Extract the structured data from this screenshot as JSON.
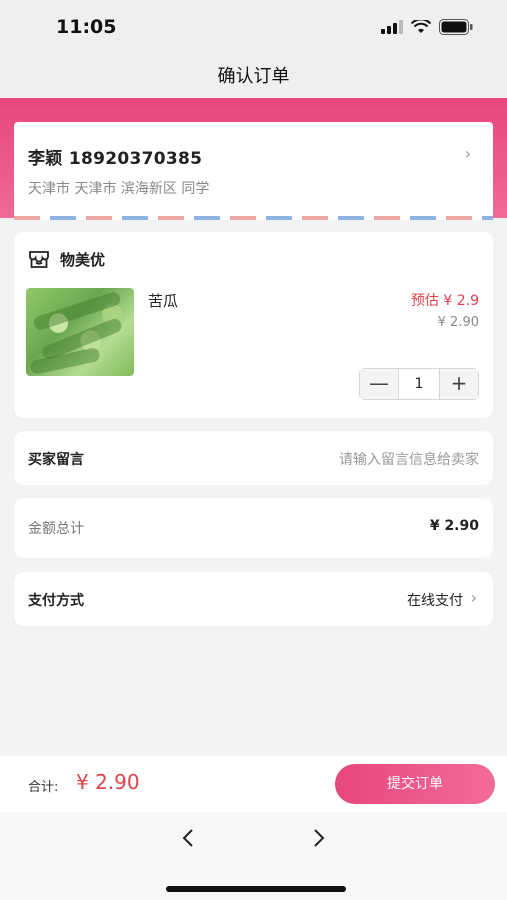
{
  "status_bar": {
    "time": "11:05"
  },
  "nav": {
    "title": "确认订单"
  },
  "address": {
    "name_phone": "李颖 18920370385",
    "detail": "天津市 天津市 滨海新区 同学"
  },
  "product_card": {
    "shop_name": "物美优",
    "product_name": "苦瓜",
    "estimated_price": "预估 ¥ 2.9",
    "price": "¥ 2.90",
    "quantity": "1",
    "minus_label": "—",
    "plus_label": "+"
  },
  "buyer_note": {
    "label": "买家留言",
    "placeholder": "请输入留言信息给卖家"
  },
  "amount": {
    "label": "金额总计",
    "value": "¥ 2.90"
  },
  "payment": {
    "label": "支付方式",
    "value": "在线支付"
  },
  "footer": {
    "total_label": "合计:",
    "total_value": "¥ 2.90",
    "submit_label": "提交订单"
  },
  "colors": {
    "brand_pink": "#e8467e",
    "price_red": "#e0434b"
  }
}
